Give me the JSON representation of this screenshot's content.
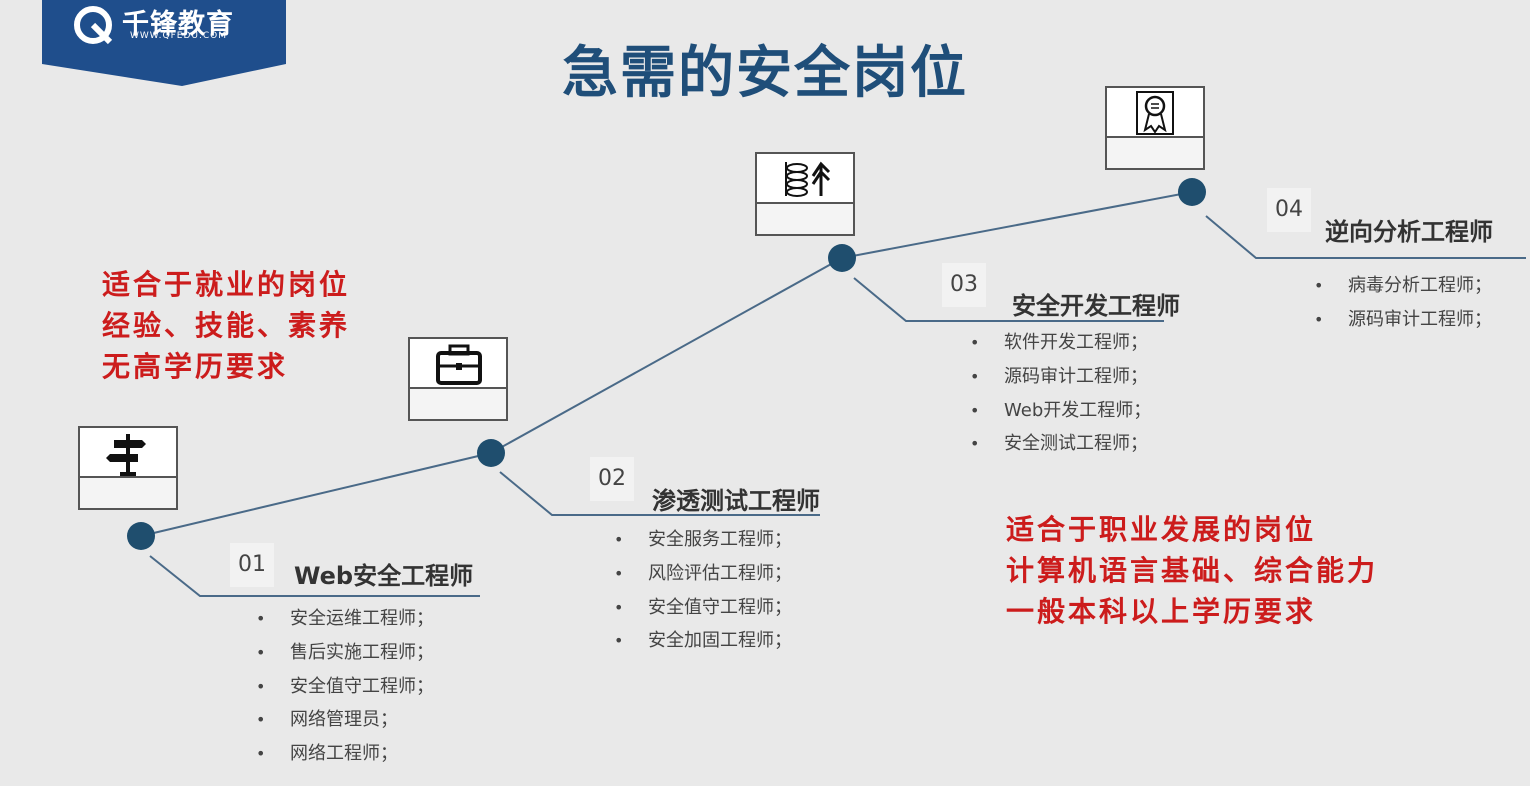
{
  "logo": {
    "name": "千锋教育",
    "url": "WWW.QFEDU.COM"
  },
  "title": "急需的安全岗位",
  "colors": {
    "title": "#1f4e79",
    "node": "#1f4e6e",
    "line": "#4a6a88",
    "note": "#cc1c1c",
    "logo_bg": "#1f4e8c"
  },
  "notes": {
    "left": [
      "适合于就业的岗位",
      "经验、技能、素养",
      "无高学历要求"
    ],
    "right": [
      "适合于职业发展的岗位",
      "计算机语言基础、综合能力",
      "一般本科以上学历要求"
    ]
  },
  "steps": [
    {
      "number": "01",
      "title": "Web安全工程师",
      "icon": "signpost-icon",
      "items": [
        "安全运维工程师；",
        "售后实施工程师；",
        "安全值守工程师；",
        "网络管理员；",
        "网络工程师；"
      ]
    },
    {
      "number": "02",
      "title": "渗透测试工程师",
      "icon": "briefcase-icon",
      "items": [
        "安全服务工程师；",
        "风险评估工程师；",
        "安全值守工程师；",
        "安全加固工程师；"
      ]
    },
    {
      "number": "03",
      "title": "安全开发工程师",
      "icon": "money-growth-icon",
      "items": [
        "软件开发工程师；",
        "源码审计工程师；",
        "Web开发工程师；",
        "安全测试工程师；"
      ]
    },
    {
      "number": "04",
      "title": "逆向分析工程师",
      "icon": "certificate-icon",
      "items": [
        "病毒分析工程师；",
        "源码审计工程师；"
      ]
    }
  ]
}
